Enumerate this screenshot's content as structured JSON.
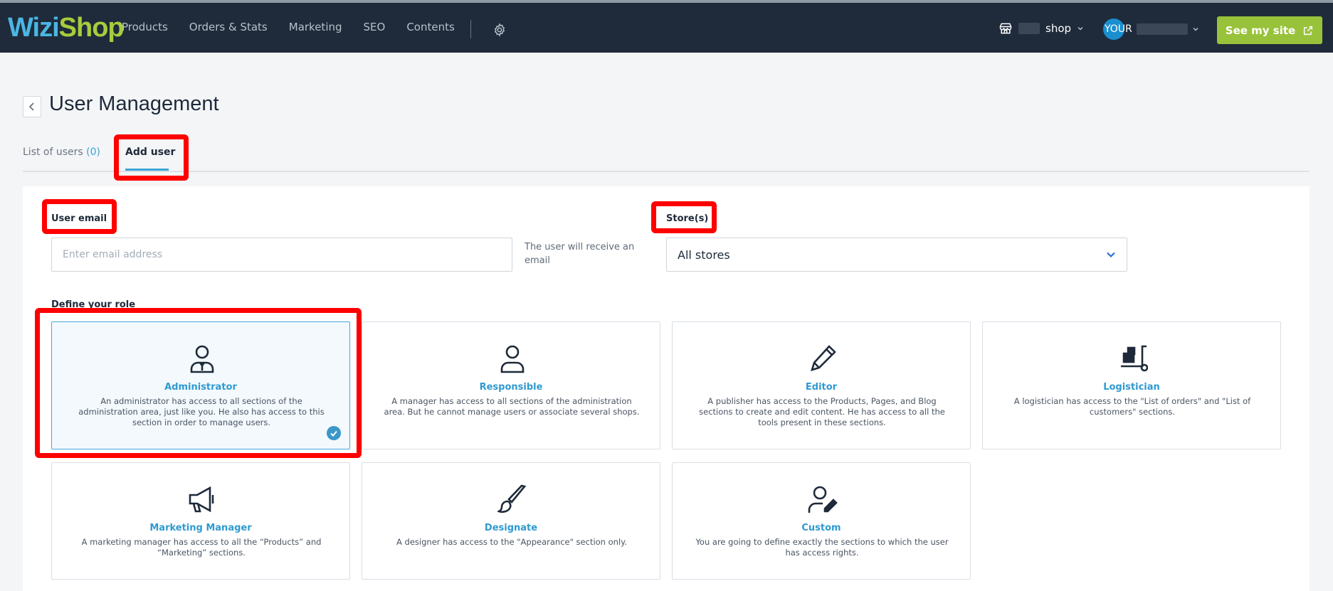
{
  "topbar": {
    "logo_part1": "Wizi",
    "logo_part2": "Shop",
    "nav": [
      "Products",
      "Orders & Stats",
      "Marketing",
      "SEO",
      "Contents"
    ],
    "shop_label": "shop",
    "user_label": "YOUR",
    "see_site": "See my site"
  },
  "header": {
    "title": "User Management"
  },
  "tabs": {
    "list_label": "List of users",
    "list_count": "(0)",
    "add_label": "Add user"
  },
  "form": {
    "email_label": "User email",
    "email_placeholder": "Enter email address",
    "email_hint": "The user will receive an email",
    "stores_label": "Store(s)",
    "stores_value": "All stores",
    "role_label": "Define your role"
  },
  "roles": [
    {
      "title": "Administrator",
      "desc": "An administrator has access to all sections of the administration area, just like you. He also has access to this section in order to manage users.",
      "icon": "administrator-icon",
      "selected": true
    },
    {
      "title": "Responsible",
      "desc": "A manager has access to all sections of the administration area. But he cannot manage users or associate several shops.",
      "icon": "user-icon",
      "selected": false
    },
    {
      "title": "Editor",
      "desc": "A publisher has access to the Products, Pages, and Blog sections to create and edit content. He has access to all the tools present in these sections.",
      "icon": "pencil-icon",
      "selected": false
    },
    {
      "title": "Logistician",
      "desc": "A logistician has access to the \"List of orders\" and \"List of customers\" sections.",
      "icon": "hand-truck-icon",
      "selected": false
    },
    {
      "title": "Marketing Manager",
      "desc": "A marketing manager has access to all the “Products” and “Marketing” sections.",
      "icon": "megaphone-icon",
      "selected": false
    },
    {
      "title": "Designate",
      "desc": "A designer has access to the \"Appearance\" section only.",
      "icon": "paintbrush-icon",
      "selected": false
    },
    {
      "title": "Custom",
      "desc": "You are going to define exactly the sections to which the user has access rights.",
      "icon": "user-edit-icon",
      "selected": false
    }
  ],
  "colors": {
    "nav_bg": "#1f2b3a",
    "accent_blue": "#2f9ad1",
    "accent_green": "#99c23b",
    "annotation_red": "#ff0000"
  }
}
